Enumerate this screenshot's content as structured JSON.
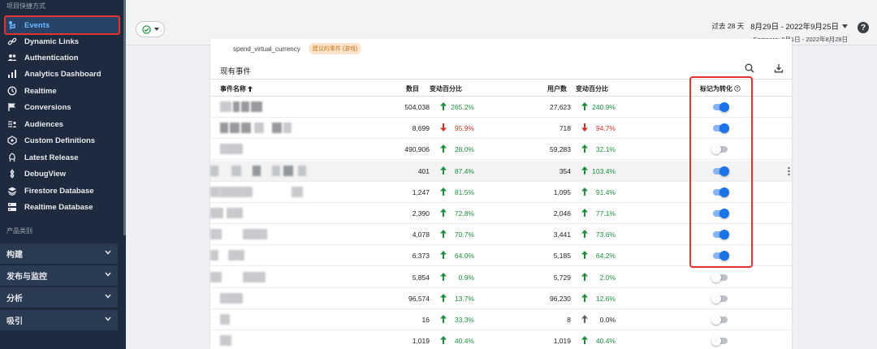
{
  "sidebar": {
    "section_shortcuts": "项目快捷方式",
    "items": [
      {
        "label": "Events",
        "icon": "events-icon",
        "active": true
      },
      {
        "label": "Dynamic Links",
        "icon": "link-icon"
      },
      {
        "label": "Authentication",
        "icon": "people-icon"
      },
      {
        "label": "Analytics Dashboard",
        "icon": "bar-chart-icon"
      },
      {
        "label": "Realtime",
        "icon": "clock-icon"
      },
      {
        "label": "Conversions",
        "icon": "flag-icon"
      },
      {
        "label": "Audiences",
        "icon": "audience-icon"
      },
      {
        "label": "Custom Definitions",
        "icon": "custom-definitions-icon"
      },
      {
        "label": "Latest Release",
        "icon": "release-icon"
      },
      {
        "label": "DebugView",
        "icon": "debug-icon"
      },
      {
        "label": "Firestore Database",
        "icon": "firestore-icon"
      },
      {
        "label": "Realtime Database",
        "icon": "database-icon"
      }
    ],
    "section_products": "产品类别",
    "groups": [
      {
        "label": "构建"
      },
      {
        "label": "发布与监控"
      },
      {
        "label": "分析"
      },
      {
        "label": "吸引"
      }
    ]
  },
  "topbar": {
    "date_prefix": "过去 28 天",
    "date_range": "8月29日 - 2022年9月25日",
    "compare": "Compare: 8月1日 - 2022年8月28日"
  },
  "card": {
    "suggested_event": "spend_virtual_currency",
    "suggested_chip": "建议的事件 (游戏)",
    "title": "现有事件",
    "headers": {
      "name": "事件名称",
      "count": "数目",
      "count_change": "变动百分比",
      "users": "用户数",
      "users_change": "变动百分比",
      "conversion": "标记为转化"
    },
    "rows": [
      {
        "count": "504,038",
        "count_dir": "up",
        "count_change": "265.2%",
        "users": "27,623",
        "users_dir": "up",
        "users_change": "240.9%",
        "conversion": true
      },
      {
        "count": "8,699",
        "count_dir": "down",
        "count_change": "95.9%",
        "users": "718",
        "users_dir": "down",
        "users_change": "94.7%",
        "conversion": true
      },
      {
        "count": "490,906",
        "count_dir": "up",
        "count_change": "28.0%",
        "users": "59,283",
        "users_dir": "up",
        "users_change": "32.1%",
        "conversion": false
      },
      {
        "count": "401",
        "count_dir": "up",
        "count_change": "87.4%",
        "users": "354",
        "users_dir": "up",
        "users_change": "103.4%",
        "conversion": true,
        "highlighted": true
      },
      {
        "count": "1,247",
        "count_dir": "up",
        "count_change": "81.5%",
        "users": "1,095",
        "users_dir": "up",
        "users_change": "91.4%",
        "conversion": true
      },
      {
        "count": "2,390",
        "count_dir": "up",
        "count_change": "72.8%",
        "users": "2,046",
        "users_dir": "up",
        "users_change": "77.1%",
        "conversion": true
      },
      {
        "count": "4,078",
        "count_dir": "up",
        "count_change": "70.7%",
        "users": "3,441",
        "users_dir": "up",
        "users_change": "73.6%",
        "conversion": true
      },
      {
        "count": "6,373",
        "count_dir": "up",
        "count_change": "64.0%",
        "users": "5,185",
        "users_dir": "up",
        "users_change": "64.2%",
        "conversion": true
      },
      {
        "count": "5,854",
        "count_dir": "up",
        "count_change": "0.9%",
        "users": "5,729",
        "users_dir": "up",
        "users_change": "2.0%",
        "conversion": false
      },
      {
        "count": "96,574",
        "count_dir": "up",
        "count_change": "13.7%",
        "users": "96,230",
        "users_dir": "up",
        "users_change": "12.6%",
        "conversion": false
      },
      {
        "count": "16",
        "count_dir": "up",
        "count_change": "33.3%",
        "users": "8",
        "users_dir": "neutral",
        "users_change": "0.0%",
        "conversion": false
      },
      {
        "count": "1,019",
        "count_dir": "up",
        "count_change": "40.4%",
        "users": "1,019",
        "users_dir": "up",
        "users_change": "40.4%",
        "conversion": false
      }
    ]
  },
  "colors": {
    "up": "#1e8e3e",
    "down": "#d93025",
    "accent": "#1a73e8",
    "highlight_box": "#e2342d"
  }
}
